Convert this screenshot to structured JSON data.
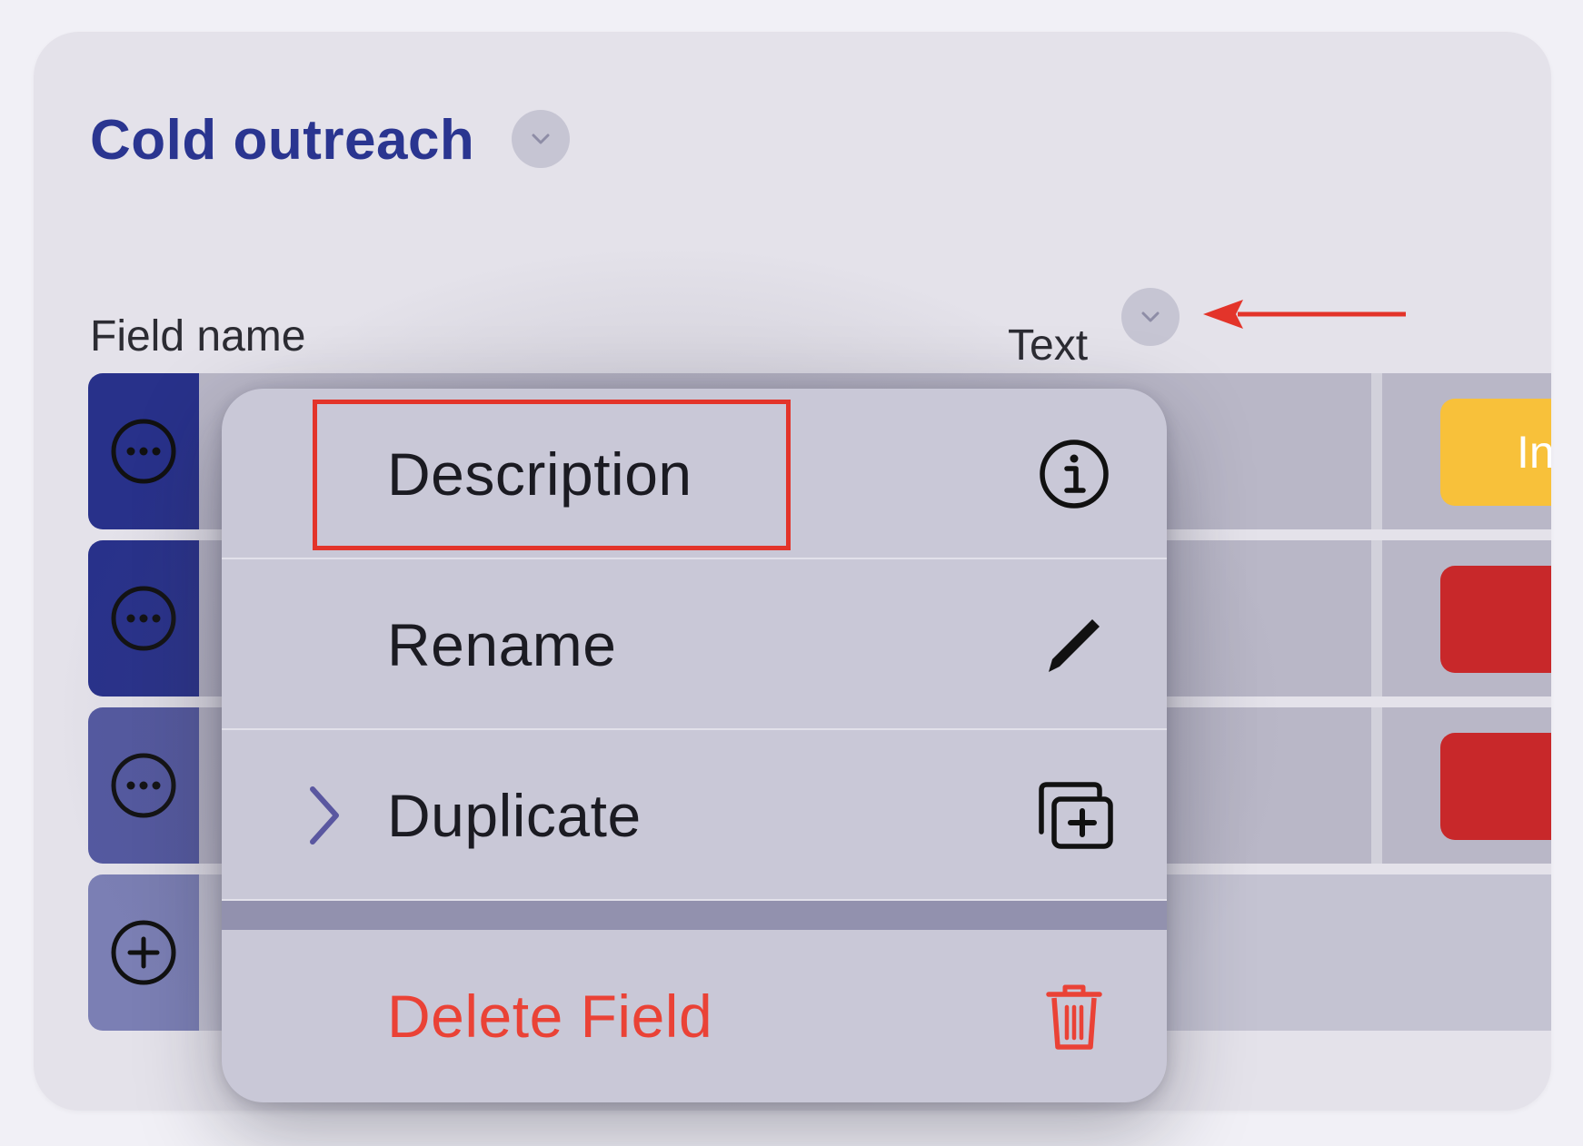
{
  "header": {
    "title": "Cold outreach"
  },
  "field": {
    "name_label": "Field name",
    "type_value": "Text"
  },
  "rows": [
    {
      "handle": "more-icon",
      "color": "#28318a",
      "tag": "In",
      "tag_color": "#f8c13a"
    },
    {
      "handle": "more-icon",
      "color": "#28318a",
      "tag": "",
      "tag_color": "#c8282a"
    },
    {
      "handle": "more-icon",
      "color": "#5459a0",
      "tag": "",
      "tag_color": "#c8282a"
    },
    {
      "handle": "add-icon",
      "color": "#7b7fb4",
      "tag": "",
      "tag_color": ""
    }
  ],
  "context_menu": {
    "items": [
      {
        "label": "Description",
        "icon": "info-icon"
      },
      {
        "label": "Rename",
        "icon": "pencil-icon"
      },
      {
        "label": "Duplicate",
        "icon": "duplicate-icon",
        "has_submenu": true
      },
      {
        "label": "Delete Field",
        "icon": "trash-icon",
        "destructive": true
      }
    ]
  },
  "annotation": {
    "highlight_color": "#e3342a",
    "arrow_color": "#e3342a"
  }
}
